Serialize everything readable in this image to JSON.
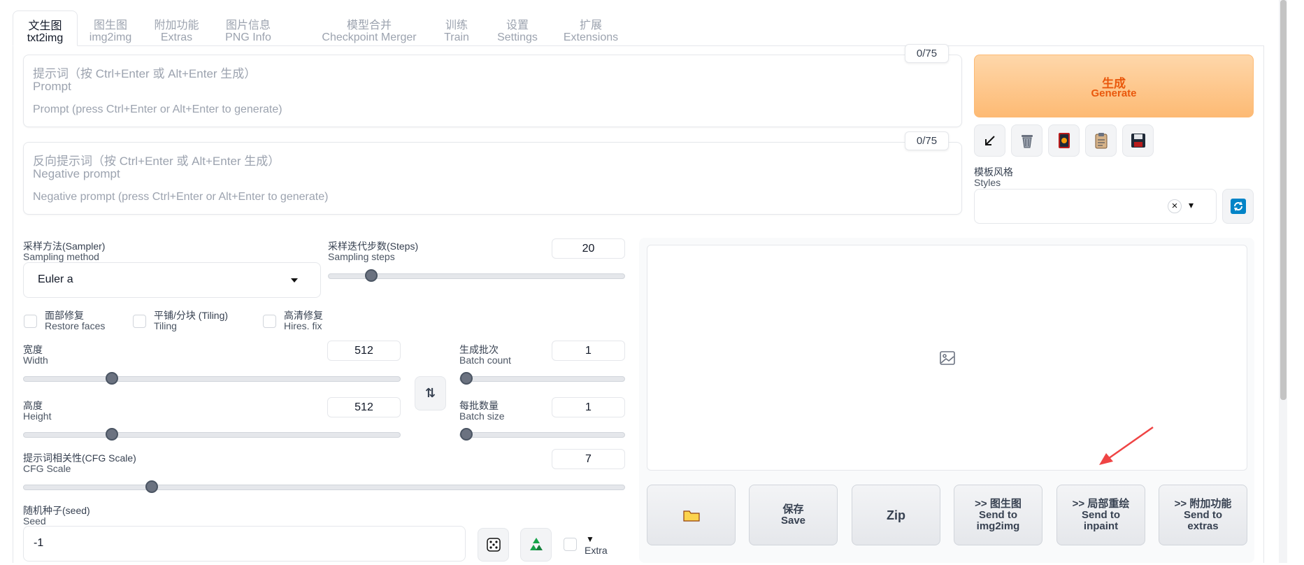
{
  "tabs": [
    {
      "zh": "文生图",
      "en": "txt2img"
    },
    {
      "zh": "图生图",
      "en": "img2img"
    },
    {
      "zh": "附加功能",
      "en": "Extras"
    },
    {
      "zh": "图片信息",
      "en": "PNG Info"
    },
    {
      "zh": "模型合并",
      "en": "Checkpoint Merger"
    },
    {
      "zh": "训练",
      "en": "Train"
    },
    {
      "zh": "设置",
      "en": "Settings"
    },
    {
      "zh": "扩展",
      "en": "Extensions"
    }
  ],
  "prompt": {
    "label_zh": "提示词（按 Ctrl+Enter 或 Alt+Enter 生成）",
    "label_en": "Prompt",
    "placeholder": "Prompt (press Ctrl+Enter or Alt+Enter to generate)",
    "counter": "0/75"
  },
  "negative_prompt": {
    "label_zh": "反向提示词（按 Ctrl+Enter 或 Alt+Enter 生成）",
    "label_en": "Negative prompt",
    "placeholder": "Negative prompt (press Ctrl+Enter or Alt+Enter to generate)",
    "counter": "0/75"
  },
  "generate": {
    "zh": "生成",
    "en": "Generate"
  },
  "tool_buttons": [
    "arrow-diagonal-icon",
    "trash-icon",
    "red-card-icon",
    "clipboard-icon",
    "floppy-disk-icon"
  ],
  "styles": {
    "label_zh": "模板风格",
    "label_en": "Styles",
    "clear": "×",
    "caret": "▾"
  },
  "sampler": {
    "label_zh": "采样方法(Sampler)",
    "label_en": "Sampling method",
    "value": "Euler a"
  },
  "steps": {
    "label_zh": "采样迭代步数(Steps)",
    "label_en": "Sampling steps",
    "value": "20",
    "min": 1,
    "max": 150
  },
  "checkboxes": [
    {
      "zh": "面部修复",
      "en": "Restore faces",
      "checked": false
    },
    {
      "zh": "平铺/分块 (Tiling)",
      "en": "Tiling",
      "checked": false
    },
    {
      "zh": "高清修复",
      "en": "Hires. fix",
      "checked": false
    }
  ],
  "width": {
    "label_zh": "宽度",
    "label_en": "Width",
    "value": "512",
    "min": 64,
    "max": 2048
  },
  "height": {
    "label_zh": "高度",
    "label_en": "Height",
    "value": "512",
    "min": 64,
    "max": 2048
  },
  "batch_count": {
    "label_zh": "生成批次",
    "label_en": "Batch count",
    "value": "1",
    "min": 1,
    "max": 100
  },
  "batch_size": {
    "label_zh": "每批数量",
    "label_en": "Batch size",
    "value": "1",
    "min": 1,
    "max": 8
  },
  "cfg": {
    "label_zh": "提示词相关性(CFG Scale)",
    "label_en": "CFG Scale",
    "value": "7",
    "min": 1,
    "max": 30
  },
  "seed": {
    "label_zh": "随机种子(seed)",
    "label_en": "Seed",
    "value": "-1",
    "extra_label": "Extra",
    "extra_caret": "▼"
  },
  "swap_glyph": "⇅",
  "output_buttons": [
    {
      "icon": "folder-icon",
      "zh": "",
      "en": ""
    },
    {
      "zh": "保存",
      "en": "Save"
    },
    {
      "zh": "",
      "en": "Zip"
    },
    {
      "zh": ">> 图生图",
      "en": "Send to img2img"
    },
    {
      "zh": ">> 局部重绘",
      "en": "Send to inpaint"
    },
    {
      "zh": ">> 附加功能",
      "en": "Send to extras"
    }
  ],
  "colors": {
    "accent_orange": "#ea580c",
    "generate_bg": "#fdba74",
    "annotation_arrow": "#ef4444"
  }
}
